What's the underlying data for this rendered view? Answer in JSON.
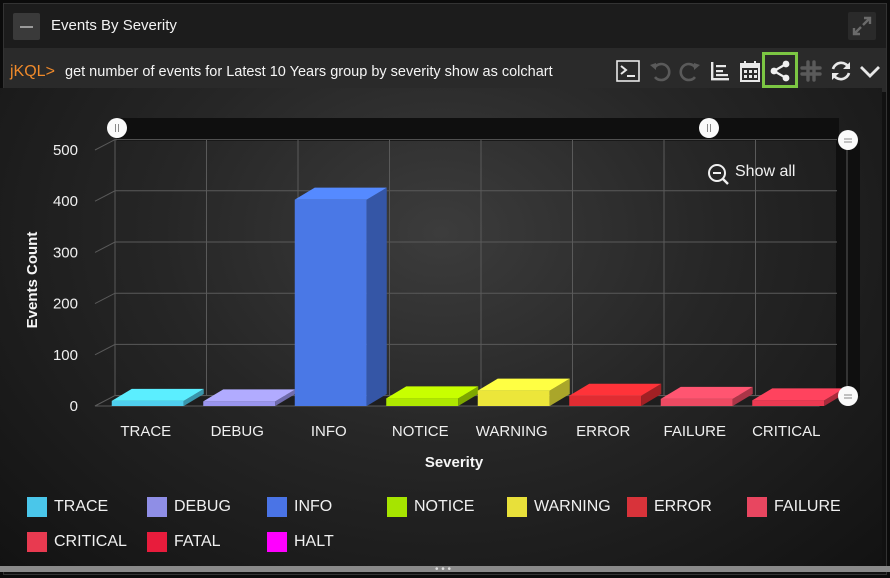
{
  "widget": {
    "title": "Events By Severity"
  },
  "command": {
    "prefix": "jKQL>",
    "query": "get number of events for Latest 10 Years group by severity show as colchart"
  },
  "toolbar": {
    "tools": [
      "terminal-icon",
      "undo-icon",
      "redo-icon",
      "list-icon",
      "calendar-icon",
      "share-icon",
      "slack-icon",
      "refresh-icon",
      "chevron-down-icon"
    ],
    "highlighted": "share-icon",
    "highlight_color": "#7cc643"
  },
  "zoom": {
    "label": "Show all"
  },
  "chart_data": {
    "type": "bar",
    "xlabel": "Severity",
    "ylabel": "Events Count",
    "ylim": [
      0,
      500
    ],
    "yticks": [
      0,
      100,
      200,
      300,
      400,
      500
    ],
    "categories": [
      "TRACE",
      "DEBUG",
      "INFO",
      "NOTICE",
      "WARNING",
      "ERROR",
      "FAILURE",
      "CRITICAL"
    ],
    "values": [
      10,
      9,
      403,
      15,
      30,
      20,
      14,
      11
    ],
    "colors": [
      "#4fcfee",
      "#9a95ee",
      "#4a78e6",
      "#aee800",
      "#ece63a",
      "#e02c32",
      "#ec4a62",
      "#ec3a52"
    ],
    "grid": true
  },
  "legend": [
    {
      "label": "TRACE",
      "color": "#4ac6ea"
    },
    {
      "label": "DEBUG",
      "color": "#8f8ee6"
    },
    {
      "label": "INFO",
      "color": "#4a74e6"
    },
    {
      "label": "NOTICE",
      "color": "#a6e400"
    },
    {
      "label": "WARNING",
      "color": "#e8e03a"
    },
    {
      "label": "ERROR",
      "color": "#d8333a"
    },
    {
      "label": "FAILURE",
      "color": "#e84660"
    },
    {
      "label": "CRITICAL",
      "color": "#e83a50"
    },
    {
      "label": "FATAL",
      "color": "#e81c3c"
    },
    {
      "label": "HALT",
      "color": "#ff00ff"
    }
  ]
}
